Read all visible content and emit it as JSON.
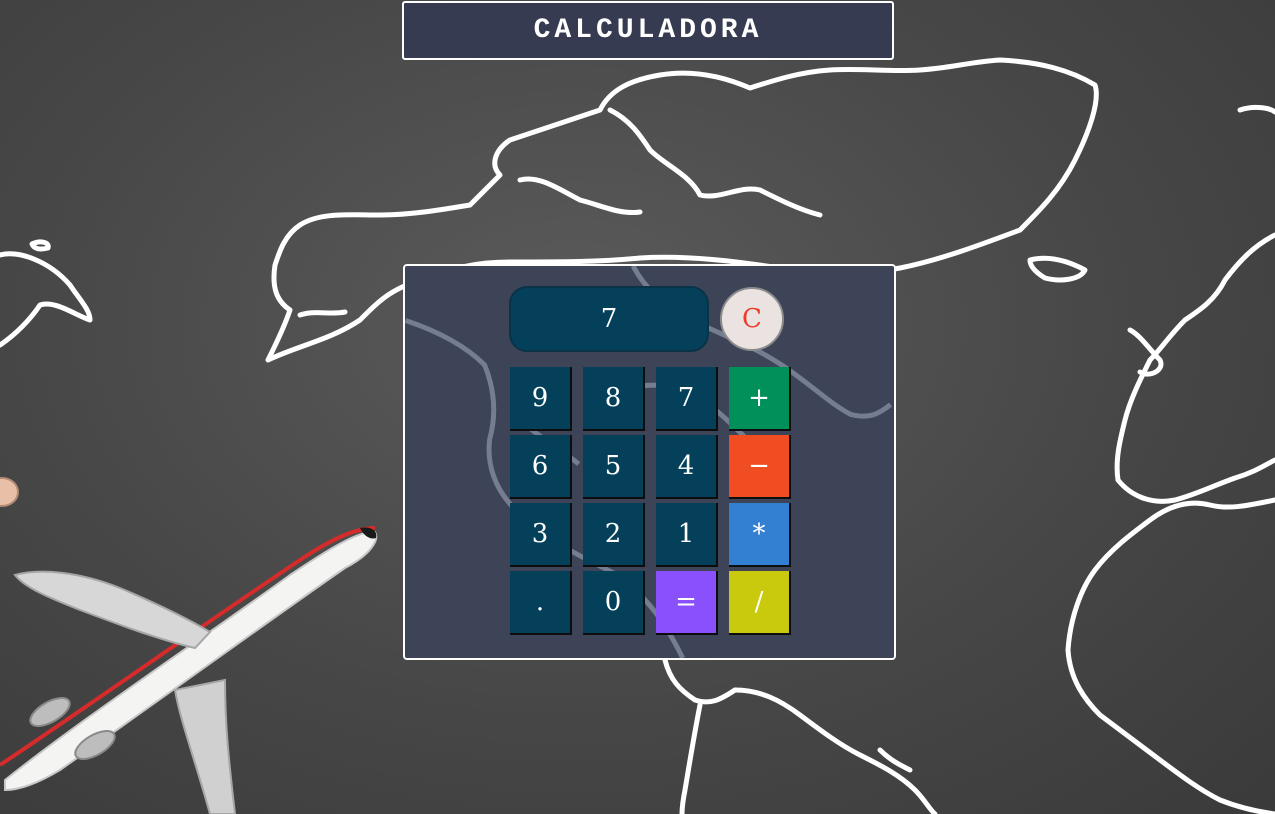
{
  "header": {
    "title": "CALCULADORA"
  },
  "calculator": {
    "display_value": "7",
    "clear_label": "C",
    "keys": {
      "k9": "9",
      "k8": "8",
      "k7": "7",
      "plus": "+",
      "k6": "6",
      "k5": "5",
      "k4": "4",
      "minus": "−",
      "k3": "3",
      "k2": "2",
      "k1": "1",
      "multiply": "*",
      "dot": ".",
      "k0": "0",
      "equals": "=",
      "divide": "/"
    }
  },
  "colors": {
    "number_key": "#04405a",
    "plus_key": "#00915a",
    "minus_key": "#f04d22",
    "multiply_key": "#3380d2",
    "equals_key": "#8950fc",
    "divide_key": "#c9c90d",
    "clear_key": "#ebe3e1",
    "clear_text": "#ee3b2b"
  },
  "background": {
    "image": "chalkboard-world-map-with-airplane"
  }
}
